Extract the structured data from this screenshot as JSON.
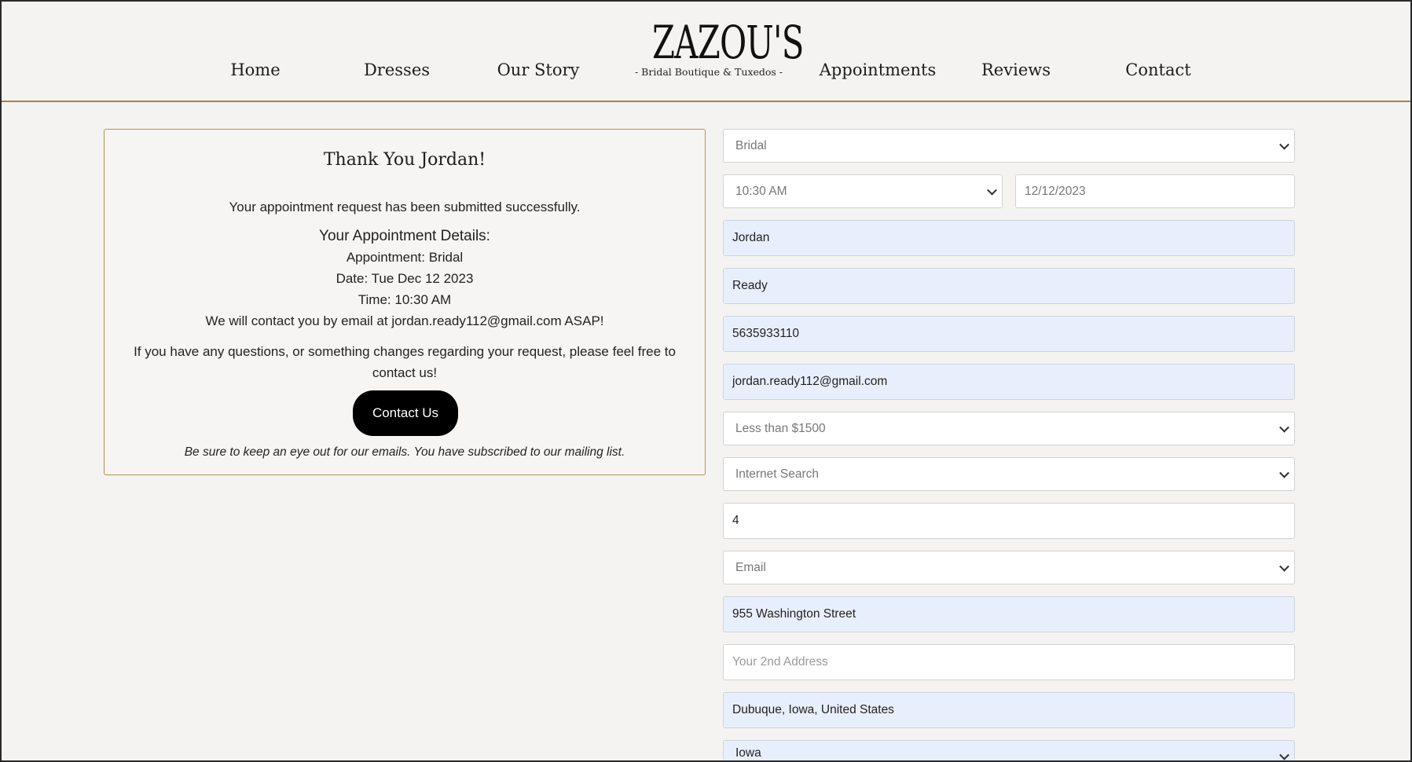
{
  "nav": {
    "home": "Home",
    "dresses": "Dresses",
    "our_story": "Our Story",
    "appointments": "Appointments",
    "reviews": "Reviews",
    "contact": "Contact"
  },
  "logo": {
    "name": "ZAZOU'S",
    "tagline": "- Bridal Boutique & Tuxedos -"
  },
  "confirmation": {
    "title": "Thank You Jordan!",
    "message": "Your appointment request has been submitted successfully.",
    "details_heading": "Your Appointment Details:",
    "appointment": "Appointment: Bridal",
    "date": "Date: Tue Dec 12 2023",
    "time": "Time: 10:30 AM",
    "email_note": "We will contact you by email at jordan.ready112@gmail.com ASAP!",
    "questions_line1": "If you have any questions, or something changes regarding your request, please feel free to",
    "questions_line2": "contact us!",
    "contact_button": "Contact Us",
    "mailing_note": "Be sure to keep an eye out for our emails. You have subscribed to our mailing list."
  },
  "form": {
    "appointment_type": "Bridal",
    "time": "10:30 AM",
    "date": "12/12/2023",
    "first_name": "Jordan",
    "last_name": "Ready",
    "phone": "5635933110",
    "email": "jordan.ready112@gmail.com",
    "budget": "Less than $1500",
    "referral": "Internet Search",
    "party_size": "4",
    "contact_method": "Email",
    "address1": "955 Washington Street",
    "address2_placeholder": "Your 2nd Address",
    "city": "Dubuque, Iowa, United States",
    "state": "Iowa"
  },
  "colors": {
    "accent": "#a6843f",
    "background": "#f4f3f1",
    "autofill": "#e8effc",
    "button": "#000000"
  }
}
